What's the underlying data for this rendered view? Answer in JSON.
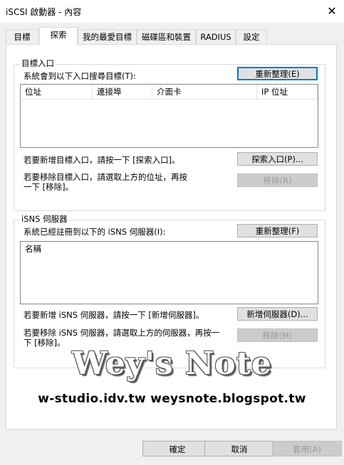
{
  "window": {
    "title": "iSCSI 啟動器 - 內容",
    "close_glyph": "✕"
  },
  "tabs": [
    {
      "label": "目標",
      "active": false
    },
    {
      "label": "探索",
      "active": true
    },
    {
      "label": "我的最愛目標",
      "active": false
    },
    {
      "label": "磁碟區和裝置",
      "active": false
    },
    {
      "label": "RADIUS",
      "active": false
    },
    {
      "label": "設定",
      "active": false
    }
  ],
  "portals": {
    "group_label": "目標入口",
    "description": "系統會到以下入口搜尋目標(T):",
    "refresh_button": "重新整理(E)",
    "columns": [
      "位址",
      "連接埠",
      "介面卡",
      "IP 位址"
    ],
    "add_text_line1": "若要新增目標入口，請按一下 [探索入口]。",
    "discover_button": "探索入口(P)...",
    "remove_text_line1": "若要移除目標入口，請選取上方的位址，再按",
    "remove_text_line2": "一下 [移除]。",
    "remove_button": "移除(R)"
  },
  "isns": {
    "group_label": "iSNS 伺服器",
    "description": "系統已經註冊到以下的 iSNS 伺服器(I):",
    "refresh_button": "重新整理(F)",
    "column_name": "名稱",
    "add_text": "若要新增 iSNS 伺服器，請按一下 [新增伺服器]。",
    "add_button": "新增伺服器(D)...",
    "remove_text_line1": "若要移除 iSNS 伺服器，請選取上方的伺服器，再按一",
    "remove_text_line2": "下 [移除]。",
    "remove_button": "移除(M)"
  },
  "watermark": {
    "title": "Wey's Note",
    "sites": "w-studio.idv.tw   weysnote.blogspot.tw"
  },
  "footer": {
    "ok": "確定",
    "cancel": "取消",
    "apply": "套用(A)"
  },
  "colors": {
    "default_button_border": "#0078d7",
    "disabled_text": "#9a9a9a"
  }
}
